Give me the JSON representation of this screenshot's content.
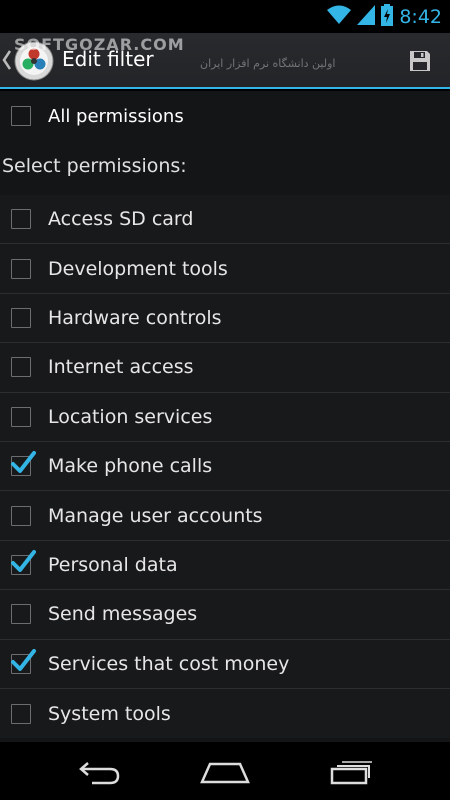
{
  "status": {
    "time": "8:42",
    "icons": [
      "wifi-icon",
      "signal-icon",
      "battery-charging-icon"
    ]
  },
  "watermark": {
    "text": "SOFTGOZAR.COM",
    "subtext": "اولین دانشگاه نرم افزار ایران"
  },
  "actionbar": {
    "title": "Edit filter",
    "save_icon": "save-icon",
    "app_icon": "app-logo-icon"
  },
  "all_permissions": {
    "label": "All permissions",
    "checked": false
  },
  "section_header": "Select permissions:",
  "permissions": [
    {
      "label": "Access SD card",
      "checked": false
    },
    {
      "label": "Development tools",
      "checked": false
    },
    {
      "label": "Hardware controls",
      "checked": false
    },
    {
      "label": "Internet access",
      "checked": false
    },
    {
      "label": "Location services",
      "checked": false
    },
    {
      "label": "Make phone calls",
      "checked": true
    },
    {
      "label": "Manage user accounts",
      "checked": false
    },
    {
      "label": "Personal data",
      "checked": true
    },
    {
      "label": "Send messages",
      "checked": false
    },
    {
      "label": "Services that cost money",
      "checked": true
    },
    {
      "label": "System tools",
      "checked": false
    }
  ],
  "navbar": {
    "buttons": [
      "back-icon",
      "home-icon",
      "recent-apps-icon"
    ]
  },
  "colors": {
    "accent": "#33b5e5",
    "background": "#141517",
    "actionbar": "#25272a"
  }
}
